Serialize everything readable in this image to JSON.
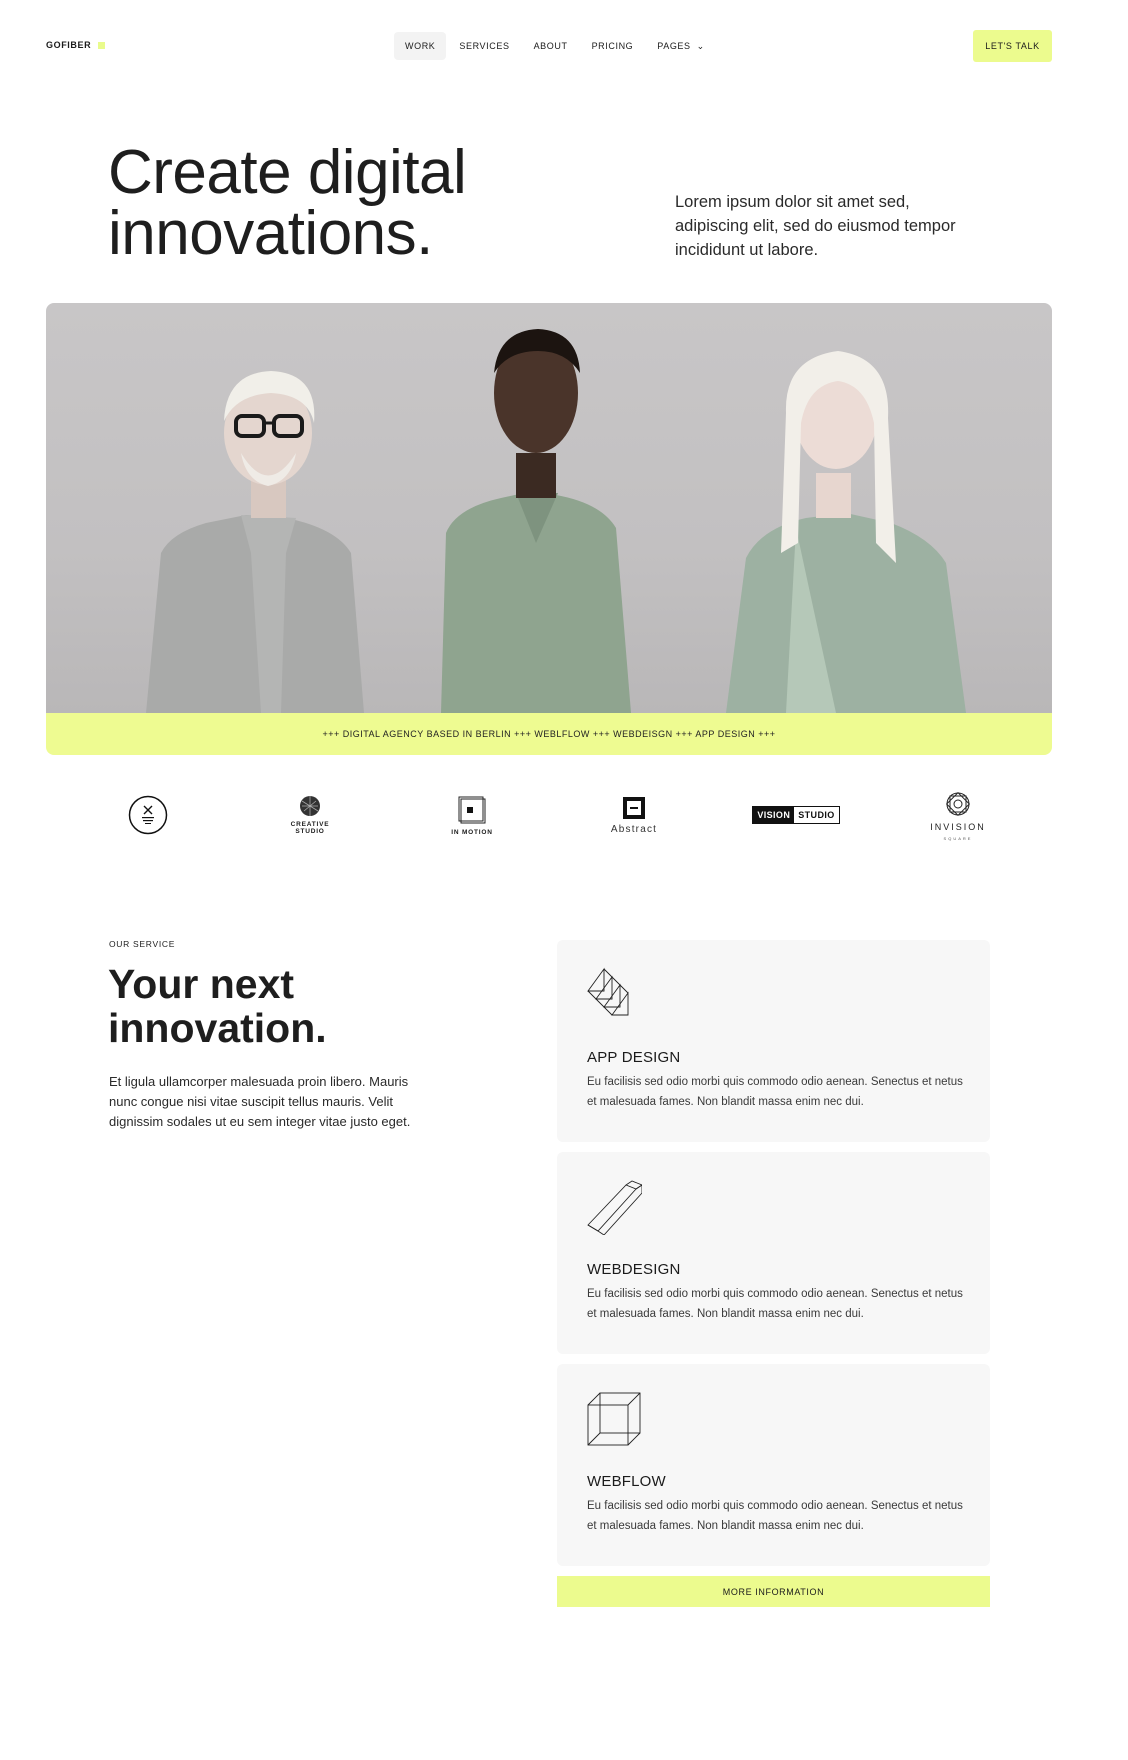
{
  "nav": {
    "logo": "GOFIBER",
    "items": [
      {
        "label": "WORK"
      },
      {
        "label": "SERVICES"
      },
      {
        "label": "ABOUT"
      },
      {
        "label": "PRICING"
      },
      {
        "label": "PAGES"
      }
    ],
    "cta": "LET'S TALK"
  },
  "hero": {
    "title_line1": "Create digital",
    "title_line2": "innovations.",
    "copy": "Lorem ipsum dolor sit amet sed, adipiscing elit, sed do eiusmod tempor incididunt ut labore.",
    "ticker": "+++ DIGITAL AGENCY BASED IN BERLIN +++ WEBLFLOW +++ WEBDEISGN +++ APP DESIGN +++"
  },
  "logos": {
    "creative_line1": "CREATIVE",
    "creative_line2": "STUDIO",
    "in_motion": "IN MOTION",
    "abstract": "Abstract",
    "vision_a": "VISION",
    "vision_b": "STUDIO",
    "invision": "INVISION",
    "invision_sub": "SQUARE"
  },
  "services": {
    "eyebrow": "OUR SERVICE",
    "title_line1": "Your next",
    "title_line2": "innovation.",
    "copy": "Et ligula ullamcorper malesuada proin libero. Mauris nunc congue nisi vitae suscipit tellus mauris. Velit dignissim sodales ut eu sem integer vitae justo eget.",
    "cards": [
      {
        "title": "APP DESIGN",
        "desc": "Eu facilisis sed odio morbi quis commodo odio aenean. Senectus et netus et malesuada fames. Non blandit massa enim nec dui.",
        "icon": "stacked-layers-icon"
      },
      {
        "title": "WEBDESIGN",
        "desc": "Eu facilisis sed odio morbi quis commodo odio aenean. Senectus et netus et malesuada fames. Non blandit massa enim nec dui.",
        "icon": "pencil-bar-icon"
      },
      {
        "title": "WEBFLOW",
        "desc": "Eu facilisis sed odio morbi quis commodo odio aenean. Senectus et netus et malesuada fames. Non blandit massa enim nec dui.",
        "icon": "wireframe-cube-icon"
      }
    ],
    "more": "MORE INFORMATION"
  },
  "colors": {
    "accent": "#ecfb8e",
    "card_bg": "#f7f7f7",
    "text": "#1b1b1b"
  }
}
